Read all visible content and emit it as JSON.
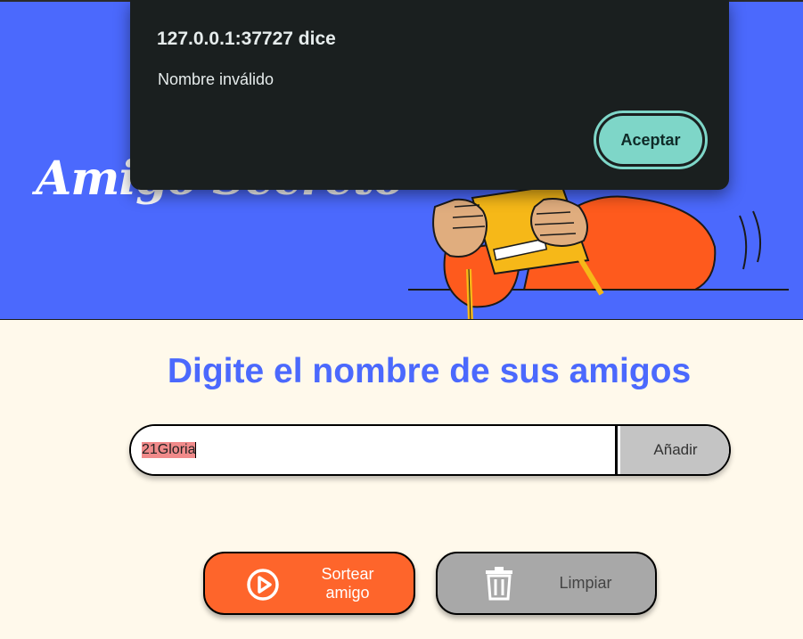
{
  "header": {
    "title": "Amigo Secreto"
  },
  "main": {
    "heading": "Digite el nombre de sus amigos",
    "input": {
      "value": "21Gloria",
      "placeholder": "Escribe un nombre"
    },
    "add_label": "Añadir",
    "draw_label": "Sortear amigo",
    "clear_label": "Limpiar"
  },
  "dialog": {
    "origin": "127.0.0.1:37727 dice",
    "message": "Nombre inválido",
    "ok_label": "Aceptar"
  },
  "icons": {
    "draw": "play-circle-icon",
    "clear": "trash-icon"
  },
  "colors": {
    "header_bg": "#4b69fd",
    "page_bg": "#fff9eb",
    "accent_blue": "#4b69fd",
    "draw_button": "#fe652b",
    "clear_button": "#a8a8a8",
    "dialog_bg": "#1a1f1f",
    "dialog_button": "#7ed6c8"
  }
}
